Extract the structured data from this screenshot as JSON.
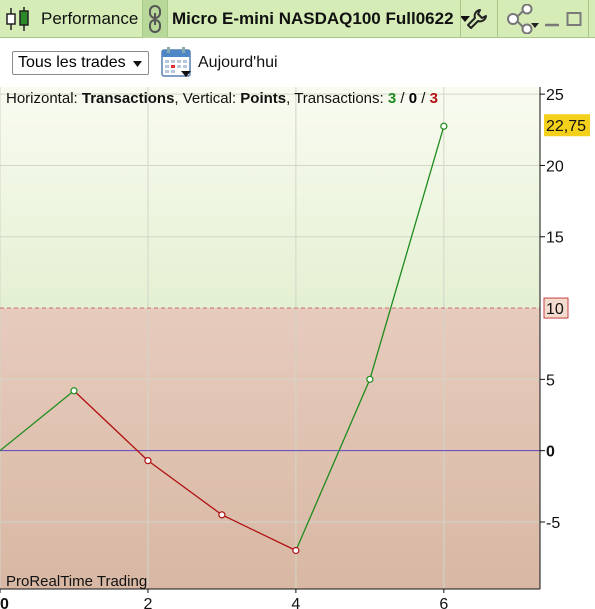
{
  "toolbar": {
    "performance_label": "Performance",
    "instrument_title": "Micro E-mini NASDAQ100 Full0622",
    "icons": [
      "candlestick-icon",
      "link-icon",
      "chevron-down-icon",
      "wrench-icon",
      "share-icon",
      "minimize-icon",
      "maximize-icon"
    ]
  },
  "controls": {
    "filter_value": "Tous les trades",
    "today_label": "Aujourd'hui",
    "icons": [
      "calendar-icon",
      "dropdown-arrow-icon"
    ]
  },
  "info": {
    "horizontal_label": "Horizontal: ",
    "horizontal_value": "Transactions",
    "vertical_label": ", Vertical: ",
    "vertical_value": "Points",
    "transactions_label": ", Transactions: ",
    "count_wins": "3",
    "count_neutral": "0",
    "count_losses": "3",
    "separator": " / "
  },
  "watermark": "ProRealTime Trading",
  "colors": {
    "win": "#1e8c1e",
    "loss": "#b01010",
    "neutral": "#000000",
    "last_value_badge": "#f3d01c",
    "threshold_badge": "#c84040",
    "zero_line": "#6040c0",
    "top_zone": "#eef5dc",
    "bottom_zone": "#e4c4b4"
  },
  "chart_data": {
    "type": "line",
    "x": [
      0,
      1,
      2,
      3,
      4,
      5,
      6
    ],
    "y": [
      0,
      4.2,
      -0.7,
      -4.5,
      -7,
      5,
      22.75
    ],
    "last_value_label": "22,75",
    "threshold": 10,
    "threshold_label": "10",
    "xlim": [
      0,
      7.3
    ],
    "ylim": [
      -9.7,
      25.5
    ],
    "x_ticks": [
      0,
      2,
      4,
      6
    ],
    "x_tick_labels": [
      "0",
      "2",
      "4",
      "6"
    ],
    "y_ticks": [
      25,
      20,
      15,
      5,
      0,
      -5
    ],
    "y_tick_labels": [
      "25",
      "20",
      "15",
      "5",
      "0",
      "-5"
    ]
  }
}
